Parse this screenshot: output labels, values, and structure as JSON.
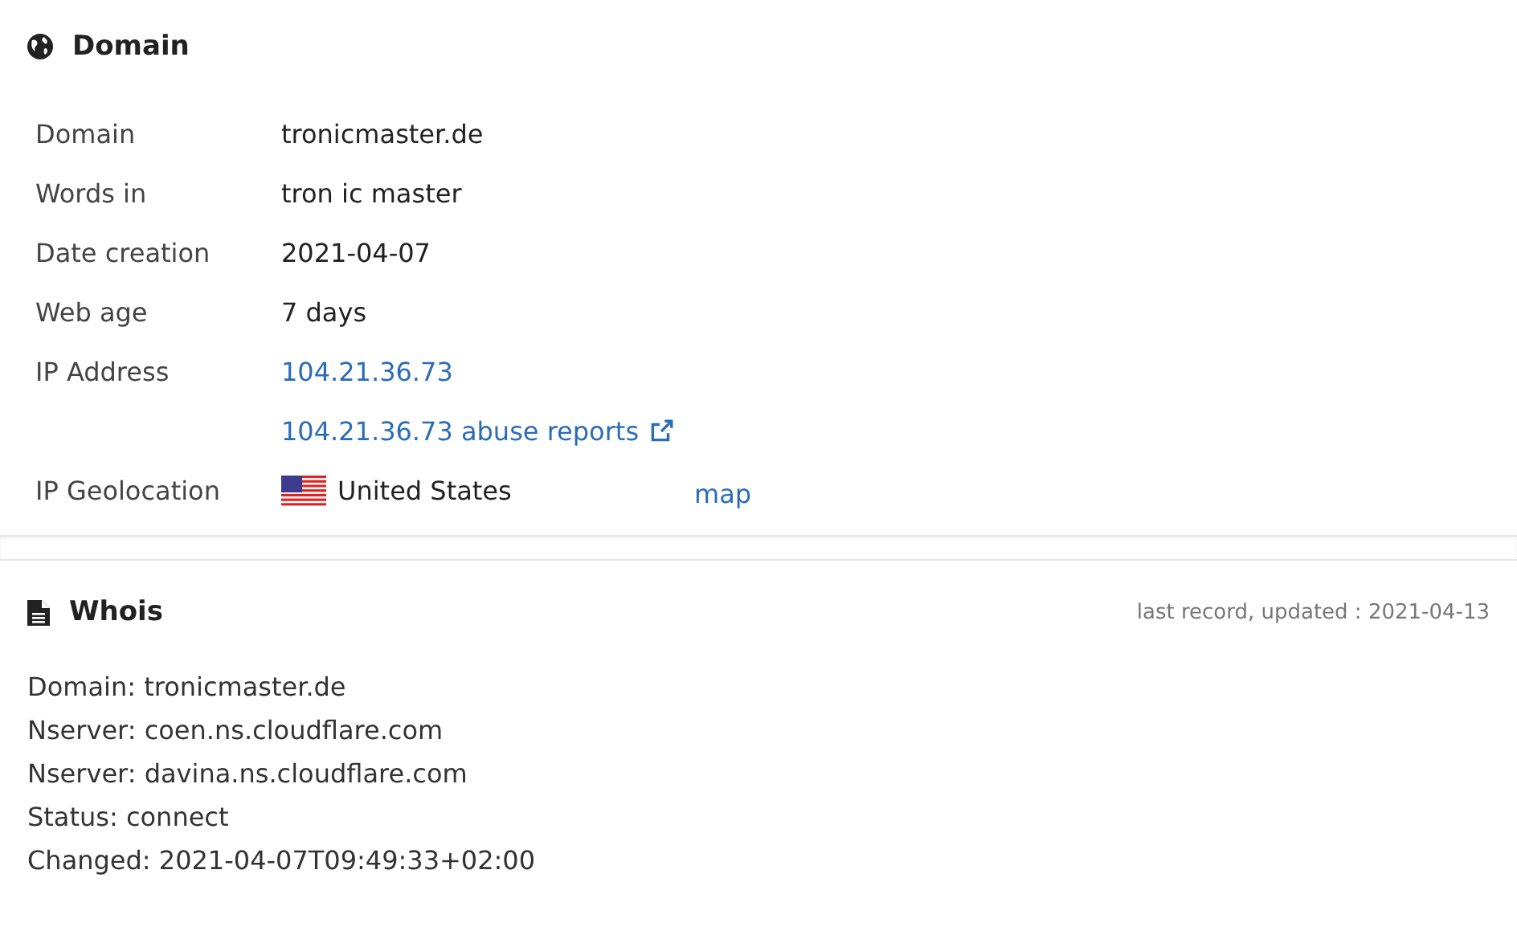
{
  "domain_section": {
    "title": "Domain",
    "rows": [
      {
        "label": "Domain",
        "kind": "text",
        "value": "tronicmaster.de"
      },
      {
        "label": "Words in",
        "kind": "text",
        "value": "tron ic master"
      },
      {
        "label": "Date creation",
        "kind": "text",
        "value": "2021-04-07"
      },
      {
        "label": "Web age",
        "kind": "text",
        "value": "7 days"
      },
      {
        "label": "IP Address",
        "kind": "link",
        "value": "104.21.36.73"
      },
      {
        "label": "",
        "kind": "external_link",
        "value": "104.21.36.73 abuse reports"
      },
      {
        "label": "IP Geolocation",
        "kind": "geo",
        "value": "United States",
        "link": "map"
      }
    ]
  },
  "whois_section": {
    "title": "Whois",
    "updated": "last record, updated : 2021-04-13",
    "lines": [
      "Domain: tronicmaster.de",
      "Nserver: coen.ns.cloudflare.com",
      "Nserver: davina.ns.cloudflare.com",
      "Status: connect",
      "Changed: 2021-04-07T09:49:33+02:00"
    ]
  }
}
